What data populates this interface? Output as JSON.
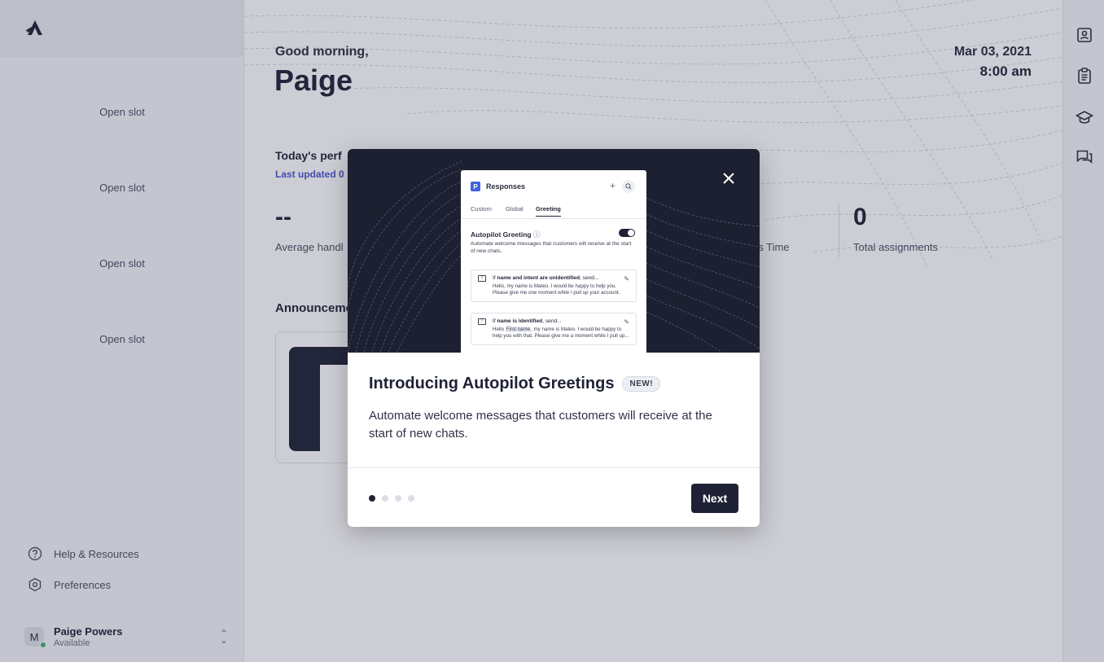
{
  "sidebar": {
    "slots": [
      "Open slot",
      "Open slot",
      "Open slot",
      "Open slot"
    ],
    "help_label": "Help & Resources",
    "preferences_label": "Preferences",
    "user": {
      "initial": "M",
      "name": "Paige Powers",
      "status": "Available"
    }
  },
  "header": {
    "greeting": "Good morning,",
    "name": "Paige",
    "date": "Mar 03, 2021",
    "time": "8:00 am"
  },
  "performance": {
    "title": "Today's perf",
    "updated": "Last updated 0",
    "metrics": [
      {
        "value": "--",
        "label": "Average handl"
      },
      {
        "value": "",
        "label": "ns Time"
      },
      {
        "value": "0",
        "label": "Total assignments"
      }
    ]
  },
  "announcements": {
    "title": "Announceme"
  },
  "modal": {
    "title": "Introducing Autopilot Greetings",
    "badge": "NEW!",
    "description": "Automate welcome messages that customers will receive at the start of new chats.",
    "next_label": "Next",
    "pages_total": 4,
    "page_active": 1,
    "preview": {
      "badge_letter": "P",
      "title": "Responses",
      "plus": "+",
      "tabs": [
        "Custom",
        "Global",
        "Greeting"
      ],
      "active_tab": "Greeting",
      "section_title": "Autopilot Greeting",
      "section_info": "ⓘ",
      "section_desc": "Automate welcome messages that customers will receive at the start of new chats.",
      "rules": [
        {
          "prefix": "If ",
          "bold": "name and intent are unidentified",
          "suffix": ", send...",
          "body": "Hello, my name is Mateo. I would be happy to help you. Please give me one moment while I pull up your account."
        },
        {
          "prefix": "If ",
          "bold": "name is identified",
          "suffix": ", send...",
          "body_before": "Hello ",
          "token": "First name",
          "body_after": ", my name is Mateo. I would be happy to help you with that. Please give me a moment while I pull up..."
        }
      ]
    }
  },
  "colors": {
    "dark": "#1f2235",
    "accent": "#4a55c8",
    "available": "#3cb371"
  }
}
